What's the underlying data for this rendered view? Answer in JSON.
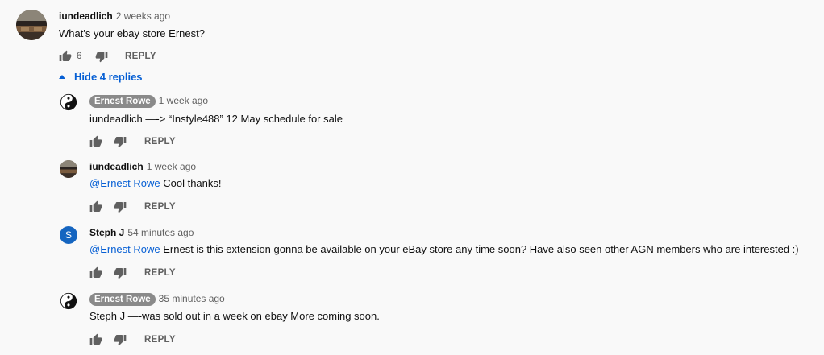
{
  "comments": [
    {
      "author": "iundeadlich",
      "time": "2 weeks ago",
      "text": "What's your ebay store Ernest?",
      "likes": "6",
      "reply": "REPLY"
    }
  ],
  "replies_toggle": "Hide 4 replies",
  "replies": [
    {
      "author": "Ernest Rowe",
      "time": "1 week ago",
      "text": "iundeadlich —-> “Instyle488” 12 May schedule for sale",
      "reply": "REPLY"
    },
    {
      "author": "iundeadlich",
      "time": "1 week ago",
      "mention": "@Ernest Rowe",
      "text": " Cool thanks!",
      "reply": "REPLY"
    },
    {
      "author": "Steph J",
      "avatar_letter": "S",
      "time": "54 minutes ago",
      "mention": "@Ernest Rowe",
      "text": " Ernest is this extension gonna be available on your eBay store any time soon? Have also seen other AGN members who are interested :)",
      "reply": "REPLY"
    },
    {
      "author": "Ernest Rowe",
      "time": "35 minutes ago",
      "text": "Steph J —-was sold out in a week on ebay More coming soon.",
      "reply": "REPLY"
    }
  ],
  "colors": {
    "link": "#065fd4",
    "chip": "#8a8a8a",
    "steph_avatar": "#1565c0",
    "muted": "#606060"
  },
  "icons": [
    "thumb-up-icon",
    "thumb-down-icon",
    "caret-up-icon",
    "yin-yang-icon"
  ]
}
